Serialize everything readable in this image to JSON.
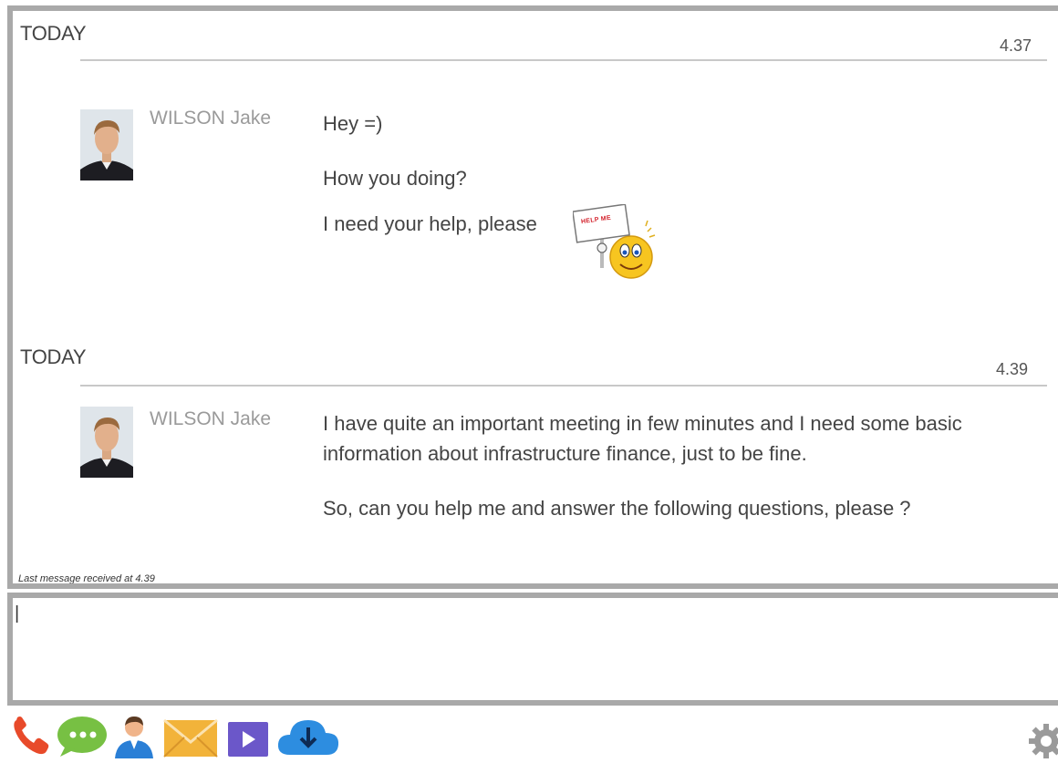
{
  "conversation": [
    {
      "day_label": "TODAY",
      "time": "4.37",
      "sender": "WILSON Jake",
      "messages": [
        "Hey =)",
        "How you doing?",
        "I need your help, please"
      ],
      "sticker_text": "HELP ME"
    },
    {
      "day_label": "TODAY",
      "time": "4.39",
      "sender": "WILSON Jake",
      "messages": [
        "I have quite an important meeting in few minutes and I need some basic",
        "information about infrastructure finance, just to be fine.",
        "So, can you help me and  answer the following questions, please ?"
      ]
    }
  ],
  "status_text": "Last message received at 4.39",
  "compose": {
    "value": "|"
  },
  "toolbar": [
    {
      "icon": "phone-icon",
      "color": "#e84a2a"
    },
    {
      "icon": "chat-bubble-icon",
      "color": "#77c043"
    },
    {
      "icon": "contact-icon",
      "color": "#2a7fd6"
    },
    {
      "icon": "mail-icon",
      "color": "#f2b33a"
    },
    {
      "icon": "video-play-icon",
      "color": "#6b57c9"
    },
    {
      "icon": "cloud-download-icon",
      "color": "#2d8de0"
    }
  ],
  "settings_icon": "gear-icon"
}
